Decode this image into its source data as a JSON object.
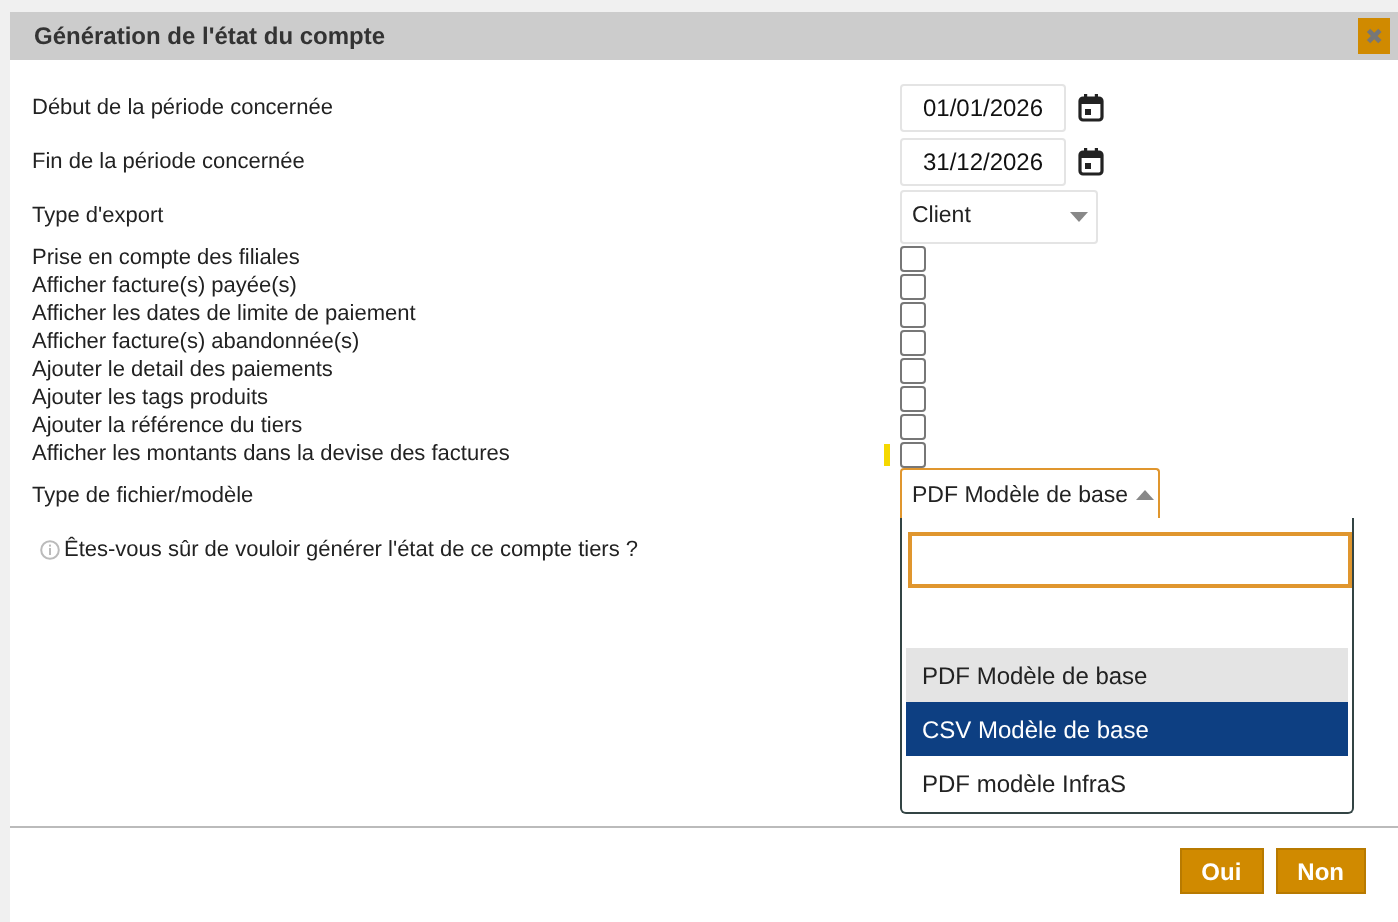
{
  "dialog": {
    "title": "Génération de l'état du compte",
    "close_icon": "✖"
  },
  "date_fields": [
    {
      "label": "Début de la période concernée",
      "value": "01/01/2026"
    },
    {
      "label": "Fin de la période concernée",
      "value": "31/12/2026"
    }
  ],
  "export_type": {
    "label": "Type d'export",
    "value": "Client"
  },
  "options": [
    {
      "label": "Prise en compte des filiales",
      "checked": false,
      "focused": false
    },
    {
      "label": "Afficher facture(s) payée(s)",
      "checked": false,
      "focused": false
    },
    {
      "label": "Afficher les dates de limite de paiement",
      "checked": false,
      "focused": false
    },
    {
      "label": "Afficher facture(s) abandonnée(s)",
      "checked": false,
      "focused": false
    },
    {
      "label": "Ajouter le detail des paiements",
      "checked": false,
      "focused": false
    },
    {
      "label": "Ajouter les tags produits",
      "checked": false,
      "focused": false
    },
    {
      "label": "Ajouter la référence du tiers",
      "checked": false,
      "focused": false
    },
    {
      "label": "Afficher les montants dans la devise des factures",
      "checked": false,
      "focused": true
    }
  ],
  "file_type": {
    "label": "Type de fichier/modèle",
    "value": "PDF Modèle de base",
    "expanded": true,
    "choices": [
      {
        "label": "PDF Modèle de base",
        "selected": true,
        "highlighted": false
      },
      {
        "label": "CSV Modèle de base",
        "selected": false,
        "highlighted": true
      },
      {
        "label": "PDF modèle InfraS",
        "selected": false,
        "highlighted": false
      }
    ]
  },
  "question": "Êtes-vous sûr de vouloir générer l'état de ce compte tiers ?",
  "buttons": [
    "Oui",
    "Non"
  ]
}
